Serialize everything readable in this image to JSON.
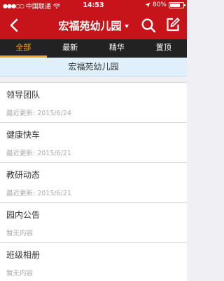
{
  "status_bar": {
    "carrier": "中国联通",
    "time": "14:53",
    "battery": "80%",
    "battery_level": 0.8
  },
  "navbar": {
    "title": "宏福苑幼儿园"
  },
  "tabs": [
    {
      "label": "全部",
      "active": true
    },
    {
      "label": "最新",
      "active": false
    },
    {
      "label": "精华",
      "active": false
    },
    {
      "label": "置顶",
      "active": false
    }
  ],
  "group_header": "宏福苑幼儿园",
  "items": [
    {
      "title": "领导团队",
      "subtitle": "最近更新: 2015/6/24"
    },
    {
      "title": "健康快车",
      "subtitle": "最近更新: 2015/6/21"
    },
    {
      "title": "教研动态",
      "subtitle": "最近更新: 2015/6/21"
    },
    {
      "title": "园内公告",
      "subtitle": "暂无内容"
    },
    {
      "title": "班级相册",
      "subtitle": "暂无内容"
    }
  ],
  "colors": {
    "brand_red": "#c7141a",
    "tab_bar": "#222222",
    "tab_active": "#f5a623",
    "header_blue": "#dff0fb"
  }
}
